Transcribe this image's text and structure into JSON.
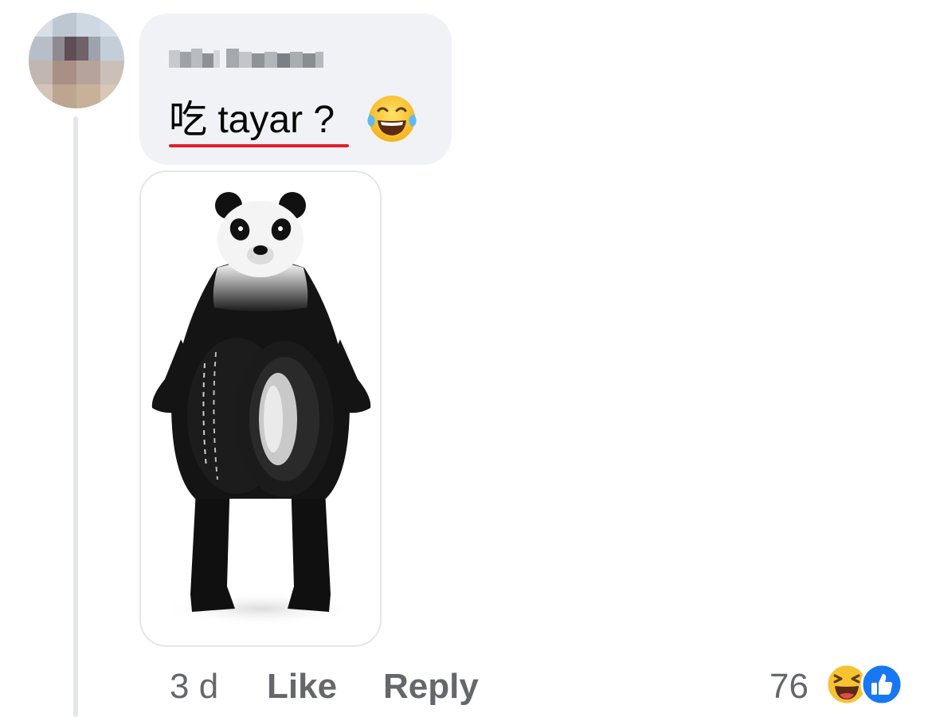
{
  "comment": {
    "text": "吃 tayar ?",
    "emoji": "face-with-tears-of-joy",
    "timestamp": "3 d",
    "like_label": "Like",
    "reply_label": "Reply",
    "reaction_count": "76",
    "reactions": [
      "haha-reaction",
      "like-reaction"
    ]
  },
  "colors": {
    "bubble_bg": "#f0f2f5",
    "meta_text": "#65676b",
    "like_blue": "#1877f2",
    "spellcheck_red": "#e0202a"
  }
}
